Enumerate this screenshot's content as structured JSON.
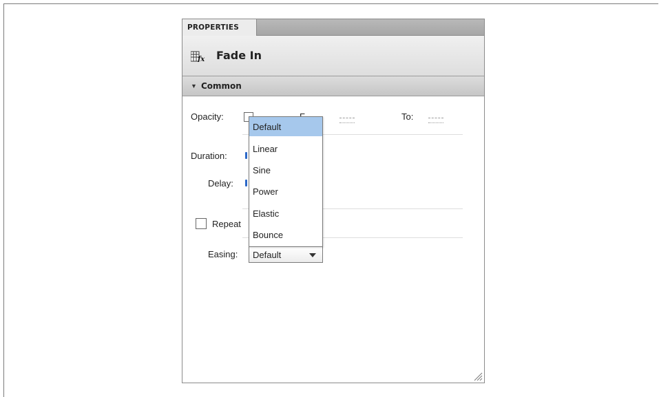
{
  "panel": {
    "tab_label": "PROPERTIES",
    "title": "Fade In",
    "title_icon": "effect-fx-icon"
  },
  "section": {
    "label": "Common",
    "expanded": true
  },
  "fields": {
    "opacity_label": "Opacity:",
    "from_label": "From:",
    "from_partial": "F",
    "to_label": "To:",
    "duration_label": "Duration:",
    "delay_label": "Delay:",
    "repeat_label": "Repeat",
    "repeat_checked": false,
    "easing_label": "Easing:"
  },
  "easing": {
    "selected": "Default",
    "options": [
      "Default",
      "Linear",
      "Sine",
      "Power",
      "Elastic",
      "Bounce"
    ],
    "highlighted_index": 0,
    "highlight_color": "#a6c8ec"
  }
}
